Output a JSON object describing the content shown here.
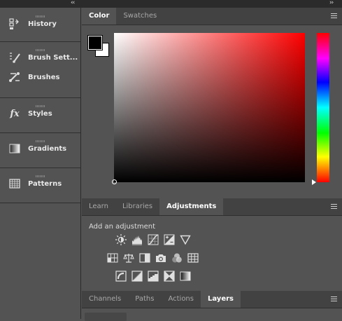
{
  "dock": {
    "collapse_glyph": "‹‹",
    "items": [
      {
        "label": "History",
        "icon": "history-icon"
      },
      {
        "label": "Brush Sett...",
        "icon": "brush-settings-icon"
      },
      {
        "label": "Brushes",
        "icon": "brushes-icon"
      },
      {
        "label": "Styles",
        "icon": "styles-fx-icon",
        "icon_text": "fx"
      },
      {
        "label": "Gradients",
        "icon": "gradients-icon"
      },
      {
        "label": "Patterns",
        "icon": "patterns-icon"
      }
    ]
  },
  "panels_collapse_glyph": "››",
  "color_panel": {
    "tabs": [
      "Color",
      "Swatches"
    ],
    "active_tab": "Color",
    "foreground_color": "#000000",
    "background_color": "#ffffff",
    "hue_color": "#ff0000"
  },
  "adjustments_panel": {
    "tabs": [
      "Learn",
      "Libraries",
      "Adjustments"
    ],
    "active_tab": "Adjustments",
    "heading": "Add an adjustment",
    "rows": [
      [
        "brightness-contrast-icon",
        "levels-icon",
        "curves-icon",
        "exposure-icon",
        "gradient-triangle-icon"
      ],
      [
        "vibrance-icon",
        "balance-icon",
        "black-white-icon",
        "photo-filter-icon",
        "channel-mixer-icon",
        "color-lookup-icon"
      ],
      [
        "invert-icon",
        "posterize-icon",
        "threshold-icon",
        "selective-color-icon",
        "gradient-map-icon"
      ]
    ]
  },
  "layers_panel": {
    "tabs": [
      "Channels",
      "Paths",
      "Actions",
      "Layers"
    ],
    "active_tab": "Layers"
  }
}
